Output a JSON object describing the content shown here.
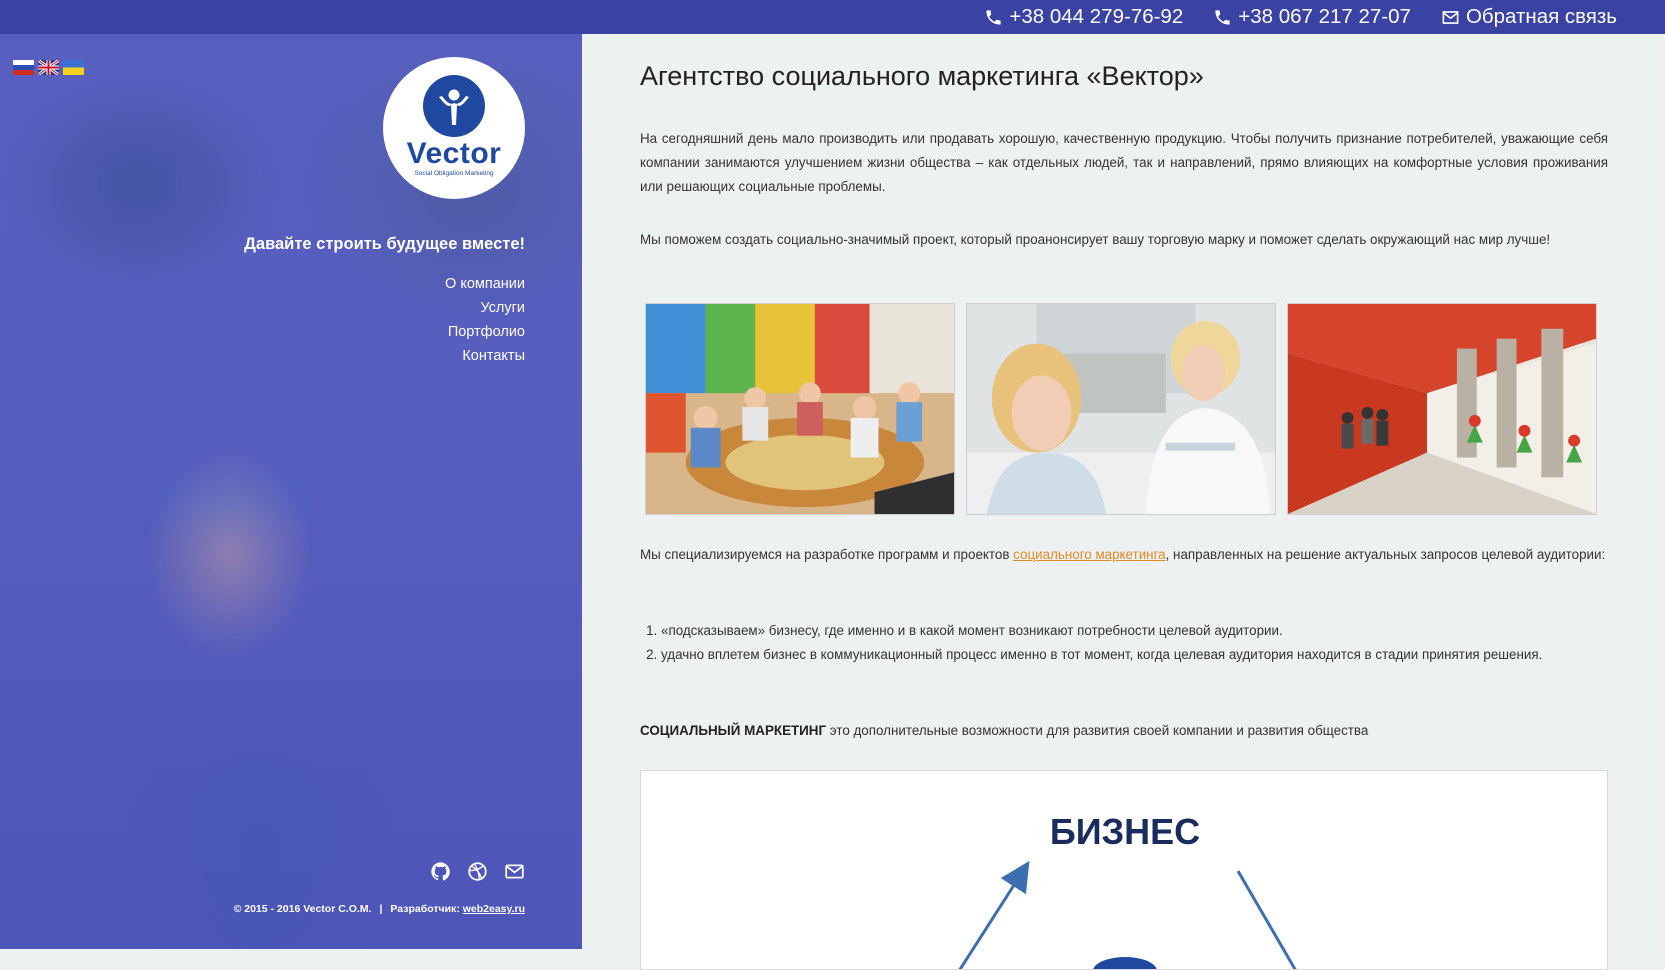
{
  "topbar": {
    "phone1": "+38 044 279-76-92",
    "phone2": "+38 067 217 27-07",
    "feedback": "Обратная связь",
    "bg_color": "#3a42a4"
  },
  "sidebar": {
    "languages": [
      "ru",
      "en",
      "ua"
    ],
    "logo": {
      "word": "Vector",
      "tagline": "Social Obligation Marketing"
    },
    "slogan": "Давайте строить будущее вместе!",
    "nav": [
      "О компании",
      "Услуги",
      "Портфолио",
      "Контакты"
    ],
    "social_icons": [
      "github-icon",
      "dribbble-icon",
      "mail-icon"
    ],
    "footer": {
      "copyright": "© 2015 - 2016 Vector C.O.M.",
      "separator": "|",
      "dev_label": "Разработчик:",
      "dev_link": "web2easy.ru"
    }
  },
  "main": {
    "title": "Агентство социального маркетинга «Вектор»",
    "paragraph1": "На сегодняшний день мало производить или продавать хорошую, качественную продукцию. Чтобы получить признание потребителей, уважающие себя компании занимаются улучшением жизни общества – как отдельных людей, так и направлений, прямо влияющих на комфортные условия проживания или решающих социальные проблемы.",
    "paragraph2": "Мы поможем создать социально-значимый проект, который проанонсирует вашу торговую марку и поможет сделать окружающий нас мир лучше!",
    "paragraph3_before": "Мы специализируемся на разработке программ и проектов ",
    "paragraph3_link": "социального маркетинга",
    "paragraph3_after": ", направленных на решение актуальных запросов целевой аудитории:",
    "list": [
      "«подсказываем» бизнесу, где именно и в какой момент возникают потребности целевой аудитории.",
      "удачно вплетем бизнес в коммуникационный процесс именно в тот момент, когда целевая аудитория находится в стадии принятия решения."
    ],
    "paragraph4_bold": "СОЦИАЛЬНЫЙ МАРКЕТИНГ",
    "paragraph4_rest": " это дополнительные возможности для развития своей компании и развития общества",
    "diagram_label": "БИЗНЕС",
    "link_color": "#e08a24"
  }
}
